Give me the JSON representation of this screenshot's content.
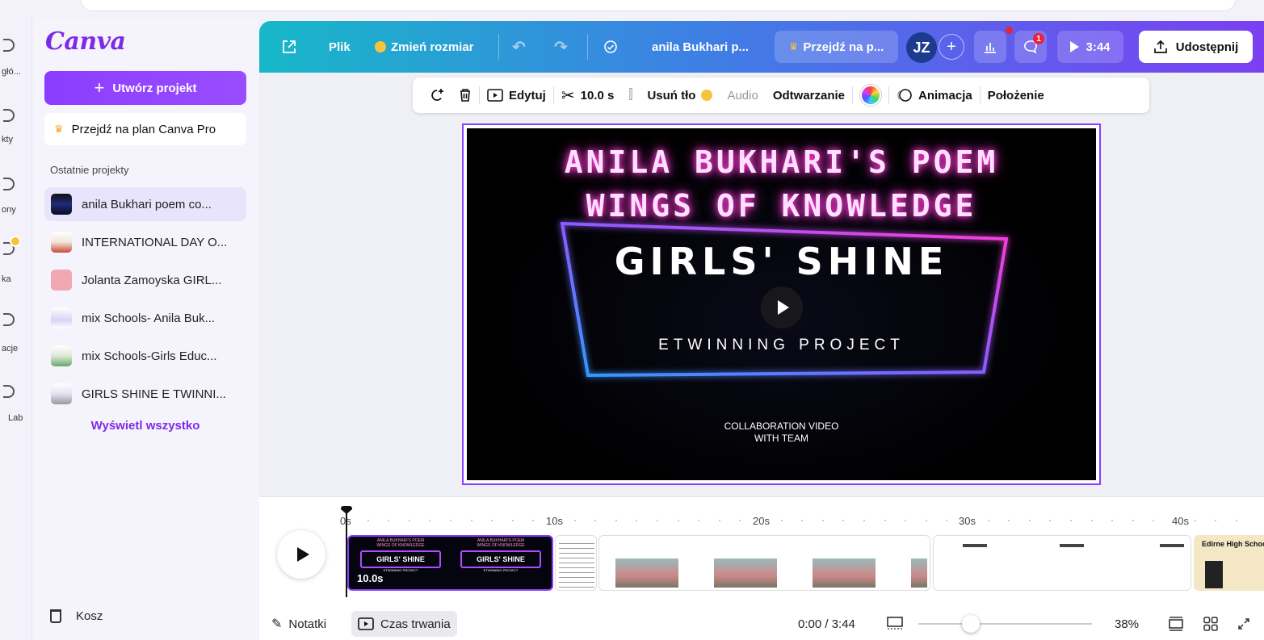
{
  "rail": {
    "items": [
      {
        "label": "głó..."
      },
      {
        "label": "kty"
      },
      {
        "label": "ony"
      },
      {
        "label": "ka"
      },
      {
        "label": "acje"
      },
      {
        "label": "Lab"
      }
    ]
  },
  "sidebar": {
    "logo": "Canva",
    "create_label": "Utwórz projekt",
    "pro_label": "Przejdź na plan Canva Pro",
    "recent_title": "Ostatnie projekty",
    "projects": [
      {
        "label": "anila Bukhari poem co..."
      },
      {
        "label": "INTERNATIONAL DAY O..."
      },
      {
        "label": "Jolanta Zamoyska GIRL..."
      },
      {
        "label": "mix Schools- Anila Buk..."
      },
      {
        "label": "mix Schools-Girls Educ..."
      },
      {
        "label": "GIRLS SHINE E TWINNI..."
      }
    ],
    "view_all": "Wyświetl wszystko",
    "trash_label": "Kosz"
  },
  "header": {
    "file_label": "Plik",
    "resize_label": "Zmień rozmiar",
    "doc_title": "anila Bukhari p...",
    "upgrade_label": "Przejdź na p...",
    "avatar_initials": "JZ",
    "comments_badge": "1",
    "present_time": "3:44",
    "share_label": "Udostępnij"
  },
  "toolbar": {
    "edit_label": "Edytuj",
    "duration_label": "10.0 s",
    "remove_bg_label": "Usuń tło",
    "audio_label": "Audio",
    "playback_label": "Odtwarzanie",
    "animation_label": "Animacja",
    "position_label": "Położenie"
  },
  "slide": {
    "title_line1": "ANILA BUKHARI'S POEM",
    "title_line2": "WINGS OF KNOWLEDGE",
    "headline": "GIRLS' SHINE",
    "subtitle": "ETWINNING PROJECT",
    "collab_line1": "COLLABORATION VIDEO",
    "collab_line2": "WITH TEAM"
  },
  "timeline": {
    "ticks": [
      "0s",
      "10s",
      "20s",
      "30s",
      "40s"
    ],
    "selected_clip_duration": "10.0s",
    "clip_headline": "GIRLS' SHINE",
    "clip_sub": "ETWINNING PROJECT",
    "last_clip_text": "Edirne High School-"
  },
  "footer": {
    "notes_label": "Notatki",
    "duration_label": "Czas trwania",
    "time_readout": "0:00 / 3:44",
    "zoom_level": "38%",
    "zoom_fraction": 0.3
  },
  "colors": {
    "accent": "#8b3dff",
    "header_start": "#17b8c8",
    "header_end": "#7b3ff2",
    "neon_pink": "#ff3bd8",
    "neon_blue": "#2f9bff"
  }
}
